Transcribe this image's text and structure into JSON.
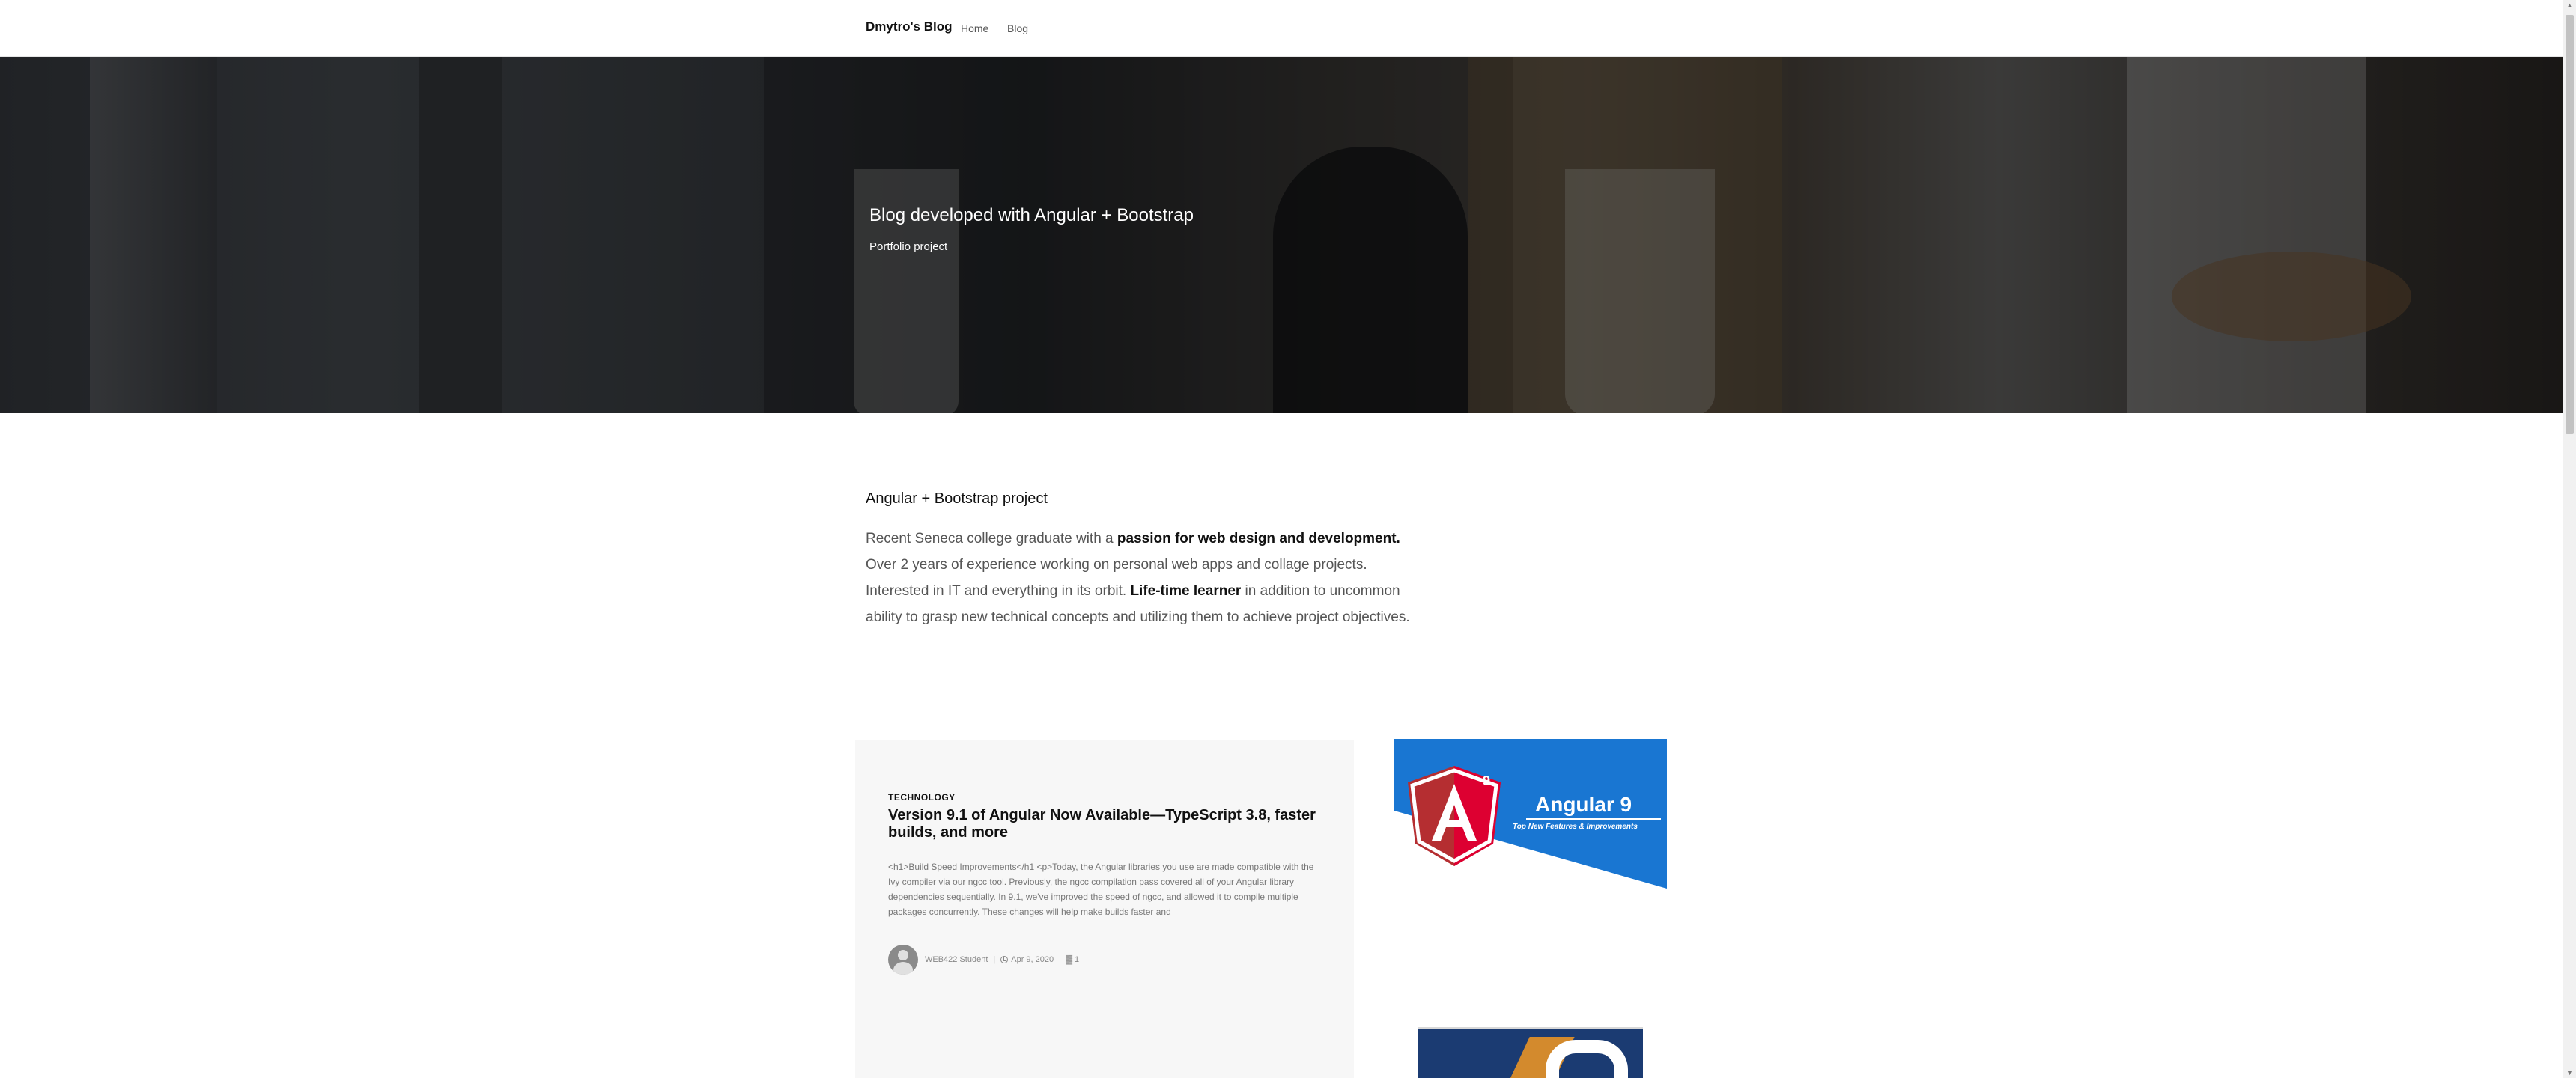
{
  "navbar": {
    "brand": "Dmytro's Blog",
    "links": [
      "Home",
      "Blog"
    ]
  },
  "hero": {
    "title": "Blog developed with Angular + Bootstrap",
    "subtitle": "Portfolio project"
  },
  "intro": {
    "heading": "Angular + Bootstrap project",
    "text_1": "Recent Seneca college graduate with a ",
    "bold_1": "passion for web design and development.",
    "text_2": " Over 2 years of experience working on personal web apps and collage projects. Interested in IT and everything in its orbit. ",
    "bold_2": "Life-time learner",
    "text_3": " in addition to uncommon ability to grasp new technical concepts and utilizing them to achieve project objectives."
  },
  "posts": [
    {
      "category": "TECHNOLOGY",
      "title": "Version 9.1 of Angular Now Available—TypeScript 3.8, faster builds, and more",
      "excerpt": "<h1>Build Speed Improvements</h1 <p>Today, the Angular libraries you use are made compatible with the Ivy compiler via our ngcc tool. Previously, the ngcc compilation pass covered all of your Angular library dependencies sequentially. In 9.1, we've improved the speed of ngcc, and allowed it to compile multiple packages concurrently. These changes will help make builds faster and",
      "author": "WEB422 Student",
      "date": "Apr 9, 2020",
      "count": "1",
      "image": {
        "title": "Angular",
        "badge_number": "9",
        "heading": "Angular 9",
        "subtitle": "Top New Features & Improvements",
        "colors": {
          "background": "#1976d2",
          "shield_dark": "#b52e31",
          "shield_light": "#dd0031"
        }
      }
    }
  ],
  "icons": {
    "avatar": "user-avatar-icon",
    "date": "clock-icon",
    "count": "stats-icon"
  }
}
